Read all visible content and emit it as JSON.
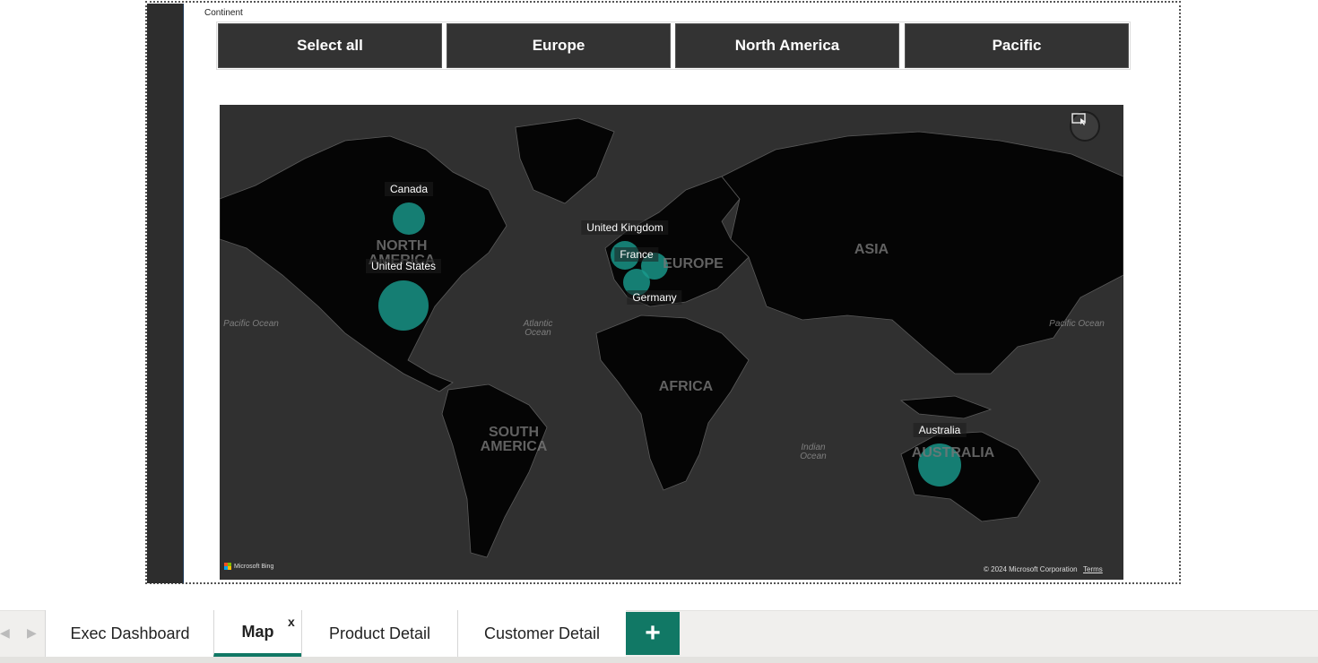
{
  "slicer": {
    "title": "Continent",
    "options": [
      "Select all",
      "Europe",
      "North America",
      "Pacific"
    ]
  },
  "map": {
    "bubble_color": "#1a9a8c",
    "countries": [
      "Canada",
      "United States",
      "United Kingdom",
      "France",
      "Germany",
      "Australia"
    ],
    "region_labels": [
      "NORTH\nAMERICA",
      "SOUTH\nAMERICA",
      "EUROPE",
      "ASIA",
      "AFRICA",
      "AUSTRALIA"
    ],
    "ocean_labels": [
      "Pacific Ocean",
      "Atlantic\nOcean",
      "Indian\nOcean",
      "Pacific Ocean"
    ],
    "brand": "Microsoft Bing",
    "copyright": "© 2024 Microsoft Corporation",
    "terms_label": "Terms"
  },
  "tabs": {
    "items": [
      "Exec Dashboard",
      "Map",
      "Product Detail",
      "Customer Detail"
    ],
    "active": "Map",
    "close_label": "x",
    "add_label": "+",
    "accent": "#117865"
  }
}
